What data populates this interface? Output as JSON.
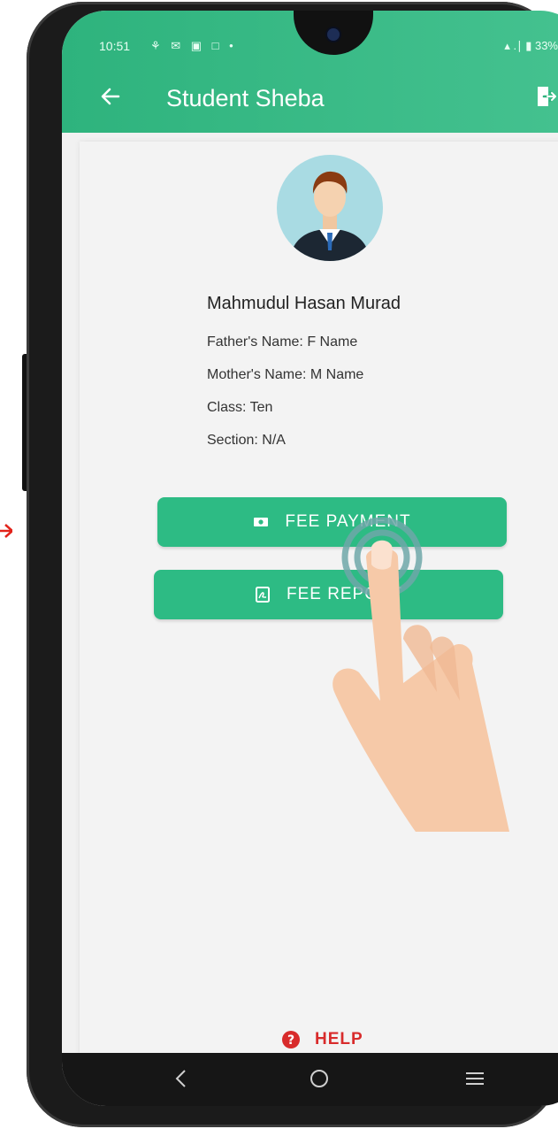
{
  "status_bar": {
    "time": "10:51",
    "notification_icons": "⚘ ✉ ▣ □ •",
    "right": "▴ .∣ ▮ 33%"
  },
  "app_bar": {
    "title": "Student Sheba",
    "back_icon": "arrow-left-icon",
    "logout_icon": "logout-icon"
  },
  "profile": {
    "name": "Mahmudul Hasan Murad",
    "father": "Father's Name: F Name",
    "mother": "Mother's Name: M Name",
    "class": "Class: Ten",
    "section": "Section: N/A"
  },
  "buttons": {
    "fee_payment": "FEE PAYMENT",
    "fee_report": "FEE REPORT"
  },
  "help": {
    "label": "HELP"
  },
  "colors": {
    "primary": "#2dbb84",
    "appbar": "#3cbf8a",
    "help": "#d82b2b"
  }
}
